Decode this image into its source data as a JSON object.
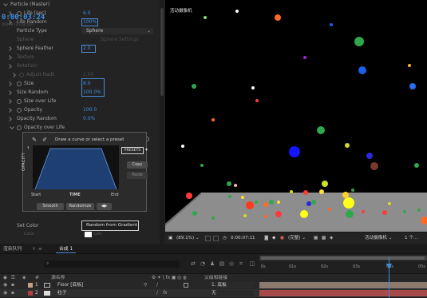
{
  "effect_controls": {
    "rows": [
      {
        "label": "Particle (Master)",
        "value": "",
        "dim": false
      },
      {
        "label": "Life [sec]",
        "value": "6.0",
        "dim": false
      },
      {
        "label": "Life Random",
        "value": "100%",
        "dim": false
      },
      {
        "label": "Particle Type",
        "value": "Sphere",
        "dim": false
      },
      {
        "label": "Sphere",
        "value": "Sphere Settings",
        "dim": true
      },
      {
        "label": "Sphere Feather",
        "value": "2.0",
        "dim": false
      },
      {
        "label": "Texture",
        "value": "",
        "dim": true
      },
      {
        "label": "Rotation",
        "value": "",
        "dim": true
      },
      {
        "label": "Adjust Radii",
        "value": "1.00",
        "dim": true
      },
      {
        "label": "Size",
        "value": "8.0",
        "dim": false
      },
      {
        "label": "Size Random",
        "value": "100.0%",
        "dim": false
      },
      {
        "label": "Size over Life",
        "value": "",
        "dim": false
      },
      {
        "label": "Opacity",
        "value": "100.0",
        "dim": false
      },
      {
        "label": "Opacity Random",
        "value": "0.0%",
        "dim": false
      },
      {
        "label": "Opacity over Life",
        "value": "",
        "dim": false
      }
    ],
    "set_color_label": "Set Color",
    "set_color_value": "Random from Gradient",
    "color_label": "Color",
    "color_value": "Life"
  },
  "curve_popup": {
    "title": "Draw a curve or select a preset",
    "y_axis_label": "OPACITY",
    "x_start": "Start",
    "x_mid": "TIME",
    "x_end": "End",
    "presets_label": "PRESETS",
    "copy_label": "Copy",
    "paste_label": "Paste",
    "smooth_label": "Smooth",
    "randomize_label": "Randomize",
    "arrows_label": "◀▶",
    "pencil_icon": "pencil-icon",
    "eraser_icon": "eraser-icon"
  },
  "viewer": {
    "camera_label": "活动摄像机",
    "zoom": "(89.1%)",
    "timecode": "0:00:07:11",
    "quality": "(完整)",
    "view": "活动摄像机",
    "view_count": "1 个..."
  },
  "timeline": {
    "tabs": [
      "渲染队列",
      "合成 1"
    ],
    "timecode": "0:00:03:24",
    "frame_info": "00099 (25.00 fps)",
    "ruler_ticks": [
      "0s",
      "01s",
      "02s",
      "03s",
      "04s",
      "05s"
    ],
    "columns": {
      "name": "源名称",
      "parent": "父级和链接"
    },
    "layers": [
      {
        "num": "1",
        "name": "Floor [底板]",
        "parent": "1. 底板",
        "color": "#c8a080"
      },
      {
        "num": "2",
        "name": "粒子",
        "parent": "无",
        "color": "#b04040"
      }
    ]
  },
  "colors": {
    "accent": "#3d8ee0",
    "panel": "#232323",
    "viewer_bg": "#000000",
    "floor": "#8a8a8a",
    "curve_fill": "#1e3f72"
  }
}
